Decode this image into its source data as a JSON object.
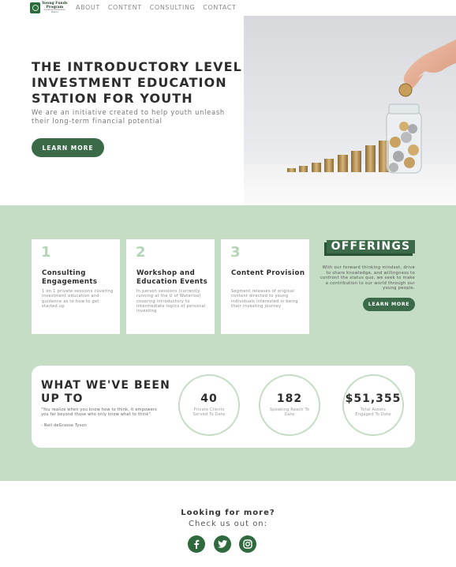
{
  "nav": {
    "logo": {
      "line1": "Young Funds",
      "line2": "Program",
      "line3": "Investment Education Station"
    },
    "links": [
      "ABOUT",
      "CONTENT",
      "CONSULTING",
      "CONTACT"
    ]
  },
  "hero": {
    "title": "THE INTRODUCTORY LEVEL INVESTMENT EDUCATION STATION FOR YOUTH",
    "subtitle": "We are an initiative created to help youth unleash their long-term financial potential",
    "button": "LEARN MORE"
  },
  "offerings": {
    "cards": [
      {
        "number": "1",
        "title": "Consulting Engagements",
        "text": "1 on 1 private sessions covering investment education and guidance as to how to get started up"
      },
      {
        "number": "2",
        "title": "Workshop and Education Events",
        "text": "In person sessions (currently running at the U of Waterloo) covering introductory to intermediate topics of personal investing"
      },
      {
        "number": "3",
        "title": "Content Provision",
        "text": "Segment releases of original content directed to young individuals interested in being their investing journey"
      }
    ],
    "title": "OFFERINGS",
    "text": "With our forward thinking mindset, drive to share knowledge, and willingness to confront the status quo, we seek to make a contribution to our world through our young people.",
    "button": "LEARN MORE"
  },
  "stats": {
    "title": "WHAT WE'VE BEEN UP TO",
    "quote": "\"You realize when you know how to think, it empowers you far beyond those who only know what to think\"",
    "author": "- Neil deGrasse Tyson",
    "items": [
      {
        "value": "40",
        "label": "Private Clients Served To Date"
      },
      {
        "value": "182",
        "label": "Speaking Reach To Date"
      },
      {
        "value": "$51,355",
        "label": "Total Assets Engaged To Date"
      }
    ]
  },
  "footer": {
    "heading": "Looking for more?",
    "subheading": "Check us out on:",
    "social": [
      {
        "icon": "facebook-icon",
        "glyph": "f"
      },
      {
        "icon": "twitter-icon",
        "glyph": "🐦"
      },
      {
        "icon": "instagram-icon",
        "glyph": "◎"
      }
    ]
  },
  "colors": {
    "accent": "#3a6a47",
    "section_bg": "#c5dcc5",
    "number_tint": "#b6d4b6"
  }
}
